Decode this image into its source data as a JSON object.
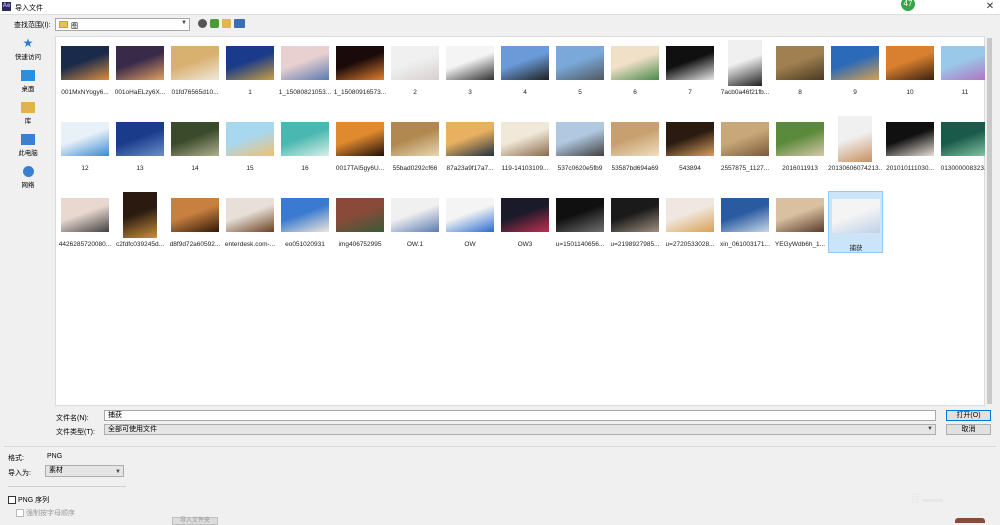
{
  "window": {
    "title": "导入文件",
    "app_icon_text": "Ae",
    "badge": "47"
  },
  "toolbar": {
    "lookin_label": "查找范围(I):",
    "lookin_value": "图"
  },
  "sidebar": [
    {
      "label": "快速访问",
      "icon": "star-icon",
      "color": "#2b78d9"
    },
    {
      "label": "桌面",
      "icon": "desktop-icon",
      "color": "#2b8fe0"
    },
    {
      "label": "库",
      "icon": "library-icon",
      "color": "#e0b44a"
    },
    {
      "label": "此电脑",
      "icon": "computer-icon",
      "color": "#3a7fd0"
    },
    {
      "label": "网络",
      "icon": "network-icon",
      "color": "#3a7fd0"
    }
  ],
  "files": [
    {
      "name": "001MxNYogy6...",
      "c1": "#1a2a4a",
      "c2": "#d89040",
      "tall": false
    },
    {
      "name": "001oHaELzy6X...",
      "c1": "#3a2a4a",
      "c2": "#e0a060",
      "tall": false
    },
    {
      "name": "01fd76565d10...",
      "c1": "#d8b070",
      "c2": "#f0e8d8",
      "tall": false
    },
    {
      "name": "1",
      "c1": "#1a3a8a",
      "c2": "#c8a040",
      "tall": false
    },
    {
      "name": "1_15080821053...",
      "c1": "#e8d0d0",
      "c2": "#5a7ab0",
      "tall": false
    },
    {
      "name": "1_15080916573...",
      "c1": "#1a0a0a",
      "c2": "#e08030",
      "tall": false
    },
    {
      "name": "2",
      "c1": "#f0f0f0",
      "c2": "#d8d0d0",
      "tall": false
    },
    {
      "name": "3",
      "c1": "#f4f4f4",
      "c2": "#303030",
      "tall": false
    },
    {
      "name": "4",
      "c1": "#6a9ad8",
      "c2": "#202020",
      "tall": false
    },
    {
      "name": "5",
      "c1": "#7aa8d8",
      "c2": "#505860",
      "tall": false
    },
    {
      "name": "6",
      "c1": "#f0e0c8",
      "c2": "#4a8a4a",
      "tall": false
    },
    {
      "name": "7",
      "c1": "#101010",
      "c2": "#e8e8e8",
      "tall": false
    },
    {
      "name": "7acb0a46f21fb...",
      "c1": "#f0f0f0",
      "c2": "#202020",
      "tall": true
    },
    {
      "name": "8",
      "c1": "#a08050",
      "c2": "#4a3a20",
      "tall": false
    },
    {
      "name": "9",
      "c1": "#2a6ab8",
      "c2": "#d8a050",
      "tall": false
    },
    {
      "name": "10",
      "c1": "#d88030",
      "c2": "#3a2010",
      "tall": false
    },
    {
      "name": "11",
      "c1": "#9ac8e8",
      "c2": "#b070c0",
      "tall": false
    },
    {
      "name": "12",
      "c1": "#e8f0f8",
      "c2": "#3a8ad0",
      "tall": false
    },
    {
      "name": "13",
      "c1": "#1a3a8a",
      "c2": "#6a90c8",
      "tall": false
    },
    {
      "name": "14",
      "c1": "#3a4a2a",
      "c2": "#b0b090",
      "tall": false
    },
    {
      "name": "15",
      "c1": "#a8d8f0",
      "c2": "#f0c070",
      "tall": false
    },
    {
      "name": "16",
      "c1": "#4ab8b0",
      "c2": "#d8f0e8",
      "tall": false
    },
    {
      "name": "0017TAI5gy6U...",
      "c1": "#e08a30",
      "c2": "#201008",
      "tall": false
    },
    {
      "name": "55bad0292cf66",
      "c1": "#b08850",
      "c2": "#e8d8b0",
      "tall": false
    },
    {
      "name": "87a23a9f17a7...",
      "c1": "#e8b060",
      "c2": "#203040",
      "tall": false
    },
    {
      "name": "119-14103109...",
      "c1": "#f0e8d8",
      "c2": "#8a6a4a",
      "tall": false
    },
    {
      "name": "537c0620e5fb9",
      "c1": "#b0c8e0",
      "c2": "#404040",
      "tall": false
    },
    {
      "name": "53587bd694a69",
      "c1": "#c8a070",
      "c2": "#f0e0c0",
      "tall": false
    },
    {
      "name": "543894",
      "c1": "#2a1a10",
      "c2": "#d8a060",
      "tall": false
    },
    {
      "name": "2557875_1127...",
      "c1": "#c8a878",
      "c2": "#7a5a3a",
      "tall": false
    },
    {
      "name": "2016011913",
      "c1": "#5a8a3a",
      "c2": "#d8c8a8",
      "tall": false
    },
    {
      "name": "20130606074213...",
      "c1": "#f0f0f0",
      "c2": "#c89060",
      "tall": true
    },
    {
      "name": "201010111030...",
      "c1": "#101010",
      "c2": "#e8e0d8",
      "tall": false
    },
    {
      "name": "013000008323...",
      "c1": "#1a5a4a",
      "c2": "#8ac8a8",
      "tall": false
    },
    {
      "name": "4426285720080...",
      "c1": "#e8d8d0",
      "c2": "#404040",
      "tall": false
    },
    {
      "name": "c2fdfc039245d...",
      "c1": "#2a1a10",
      "c2": "#c89040",
      "tall": true
    },
    {
      "name": "d8f9d72a60592...",
      "c1": "#c88040",
      "c2": "#301808",
      "tall": false
    },
    {
      "name": "enterdesk.com-...",
      "c1": "#e8e0d8",
      "c2": "#6a4020",
      "tall": false
    },
    {
      "name": "eo051020931",
      "c1": "#3a7ad0",
      "c2": "#f0e8d8",
      "tall": false
    },
    {
      "name": "img406752995",
      "c1": "#8a4a3a",
      "c2": "#3a5a3a",
      "tall": false
    },
    {
      "name": "OW.1",
      "c1": "#f0f0f0",
      "c2": "#5a7ab0",
      "tall": false
    },
    {
      "name": "OW",
      "c1": "#f4f4f4",
      "c2": "#2a6ad0",
      "tall": false
    },
    {
      "name": "OW3",
      "c1": "#1a1a2a",
      "c2": "#c03050",
      "tall": false
    },
    {
      "name": "u=1501140656...",
      "c1": "#101010",
      "c2": "#707070",
      "tall": false
    },
    {
      "name": "u=2198927985...",
      "c1": "#1a1a1a",
      "c2": "#a09080",
      "tall": false
    },
    {
      "name": "u=2720533028...",
      "c1": "#f0e8e0",
      "c2": "#d8a050",
      "tall": false
    },
    {
      "name": "xin_061003171...",
      "c1": "#2a5aa0",
      "c2": "#c8d8e8",
      "tall": false
    },
    {
      "name": "YEGyWdb6h_1...",
      "c1": "#d8c0a0",
      "c2": "#5a3a2a",
      "tall": false
    },
    {
      "name": "捕获",
      "c1": "#f4f4f4",
      "c2": "#c0d0e8",
      "tall": false,
      "selected": true
    }
  ],
  "filename": {
    "label": "文件名(N):",
    "value": "捕获"
  },
  "filetype": {
    "label": "文件类型(T):",
    "value": "全部可使用文件"
  },
  "buttons": {
    "open": "打开(O)",
    "cancel": "取消",
    "import_folder": "导入文件夹"
  },
  "options": {
    "format_label": "格式:",
    "format_value": "PNG",
    "import_as_label": "导入为:",
    "import_as_value": "素材",
    "png_sequence": "PNG 序列",
    "alpha_order": "强制按字母顺序"
  },
  "watermark": "百 ▬▬"
}
